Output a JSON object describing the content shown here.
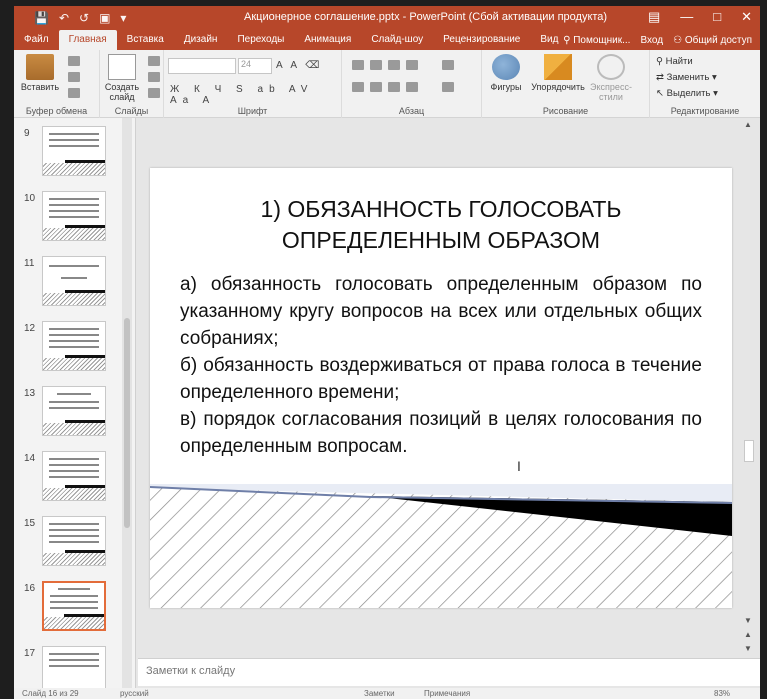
{
  "titlebar": {
    "title": "Акционерное соглашение.pptx - PowerPoint (Сбой активации продукта)",
    "qat": [
      "save-icon",
      "undo-icon",
      "redo-icon",
      "present-icon",
      "customize-icon"
    ],
    "controls": [
      "ribbon-options-icon",
      "minimize-icon",
      "maximize-icon",
      "close-icon"
    ]
  },
  "tabs": {
    "items": [
      "Файл",
      "Главная",
      "Вставка",
      "Дизайн",
      "Переходы",
      "Анимация",
      "Слайд-шоу",
      "Рецензирование",
      "Вид"
    ],
    "active": "Главная",
    "tell_me": "Помощник...",
    "signin": "Вход",
    "share": "Общий доступ"
  },
  "ribbon": {
    "clipboard": {
      "label": "Буфер обмена",
      "paste": "Вставить"
    },
    "slides": {
      "label": "Слайды",
      "new_slide_1": "Создать",
      "new_slide_2": "слайд"
    },
    "font": {
      "label": "Шрифт",
      "size": "24",
      "format_buttons": "Ж К Ч S ab AV Aa A"
    },
    "paragraph": {
      "label": "Абзац"
    },
    "drawing": {
      "label": "Рисование",
      "shapes": "Фигуры",
      "arrange": "Упорядочить",
      "quick_styles_1": "Экспресс-",
      "quick_styles_2": "стили"
    },
    "editing": {
      "label": "Редактирование",
      "find": "Найти",
      "replace": "Заменить",
      "select": "Выделить"
    }
  },
  "thumbnails": {
    "items": [
      {
        "num": "9"
      },
      {
        "num": "10"
      },
      {
        "num": "11"
      },
      {
        "num": "12"
      },
      {
        "num": "13"
      },
      {
        "num": "14"
      },
      {
        "num": "15"
      },
      {
        "num": "16"
      },
      {
        "num": "17"
      }
    ],
    "selected": "16"
  },
  "slide": {
    "title_line1": "1) ОБЯЗАННОСТЬ ГОЛОСОВАТЬ",
    "title_line2": "ОПРЕДЕЛЕННЫМ ОБРАЗОМ",
    "para_a": "а) обязанность голосовать определенным образом по указанному кругу вопросов на всех или отдельных общих собраниях;",
    "para_b": "б) обязанность воздерживаться от права голоса в течение определенного времени;",
    "para_c": "в) порядок согласования позиций в целях голосования по определенным вопросам."
  },
  "notes": {
    "placeholder": "Заметки к слайду"
  },
  "status": {
    "slide_info": "Слайд 16 из 29",
    "language": "русский",
    "notes_btn": "Заметки",
    "comments_btn": "Примечания",
    "zoom": "83%"
  },
  "colors": {
    "accent": "#b7472a",
    "selected_thumb": "#e36c3a"
  }
}
